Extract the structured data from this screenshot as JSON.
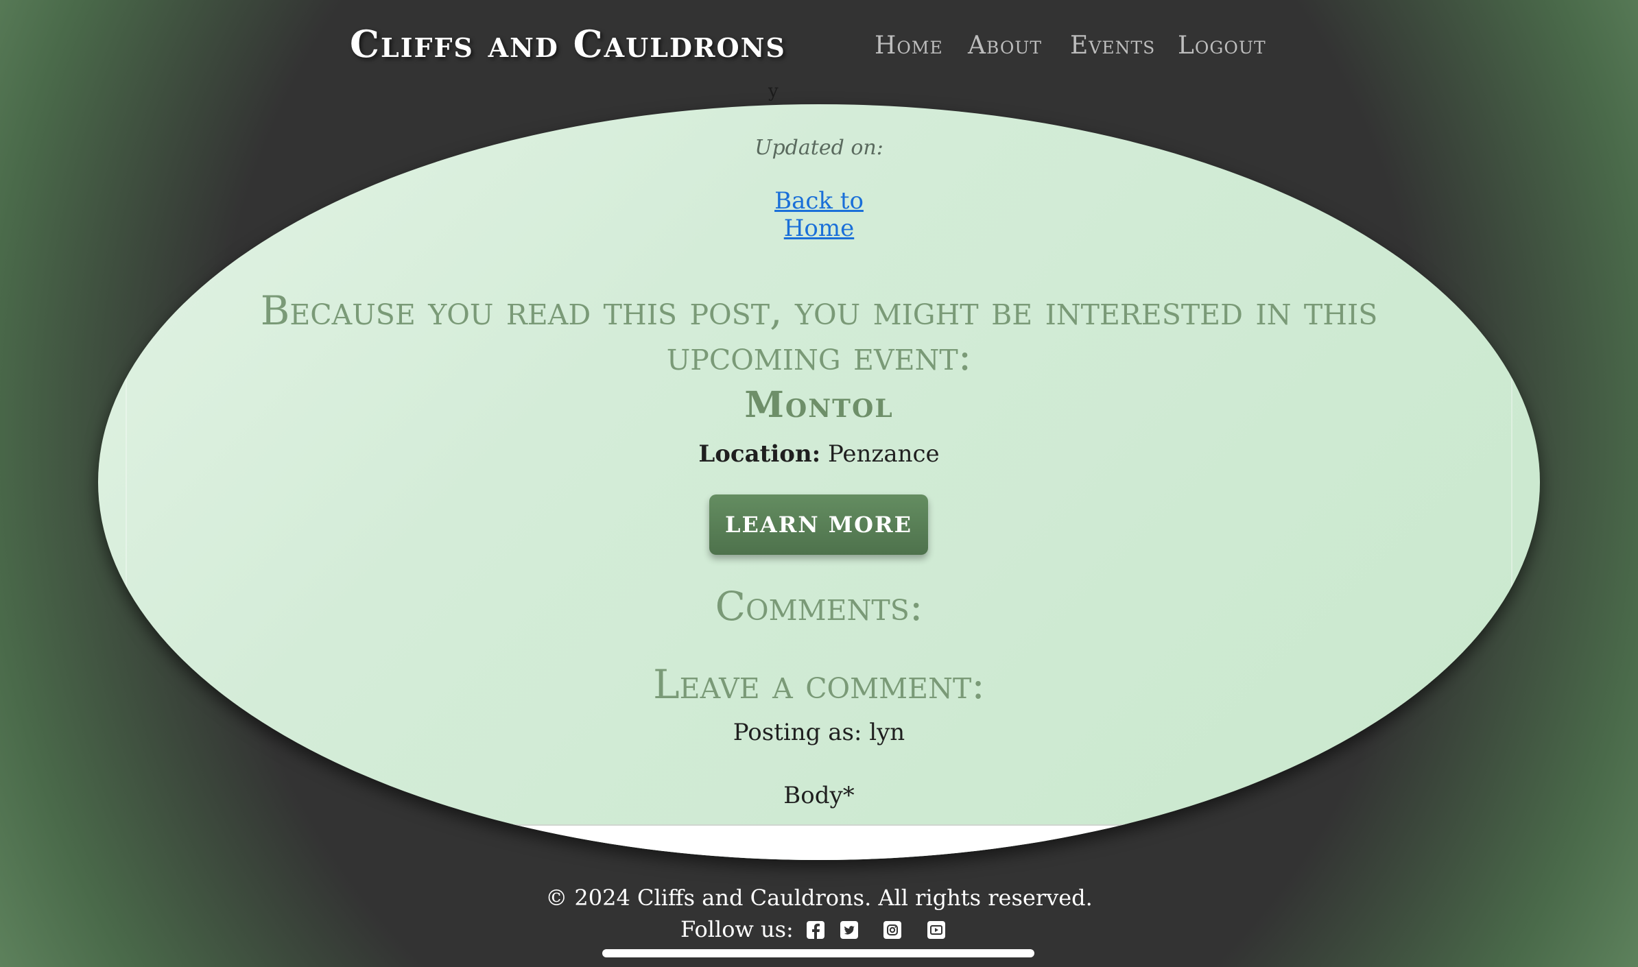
{
  "nav": {
    "brand": "Cliffs and Cauldrons",
    "links": [
      "Home",
      "About",
      "Events",
      "Logout"
    ]
  },
  "post": {
    "partial_text": "y",
    "updated_label": "Updated on:",
    "back_link": "Back to Home"
  },
  "event": {
    "heading": "Because you read this post, you might be interested in this upcoming event:",
    "name": "Montol",
    "location_label": "Location:",
    "location_value": "Penzance",
    "button_label": "LEARN MORE"
  },
  "comments": {
    "heading": "Comments:",
    "leave_heading": "Leave a comment:",
    "posting_as": "Posting as: lyn",
    "body_label": "Body*"
  },
  "footer": {
    "copyright": "© 2024 Cliffs and Cauldrons. All rights reserved.",
    "follow_label": "Follow us:",
    "social_icons": [
      "facebook-icon",
      "twitter-icon",
      "instagram-icon",
      "youtube-icon"
    ]
  },
  "colors": {
    "accent_green": "#7a9a77",
    "button_green": "#5a8257",
    "link_blue": "#1a6fd8",
    "dark_bg": "#333333"
  }
}
